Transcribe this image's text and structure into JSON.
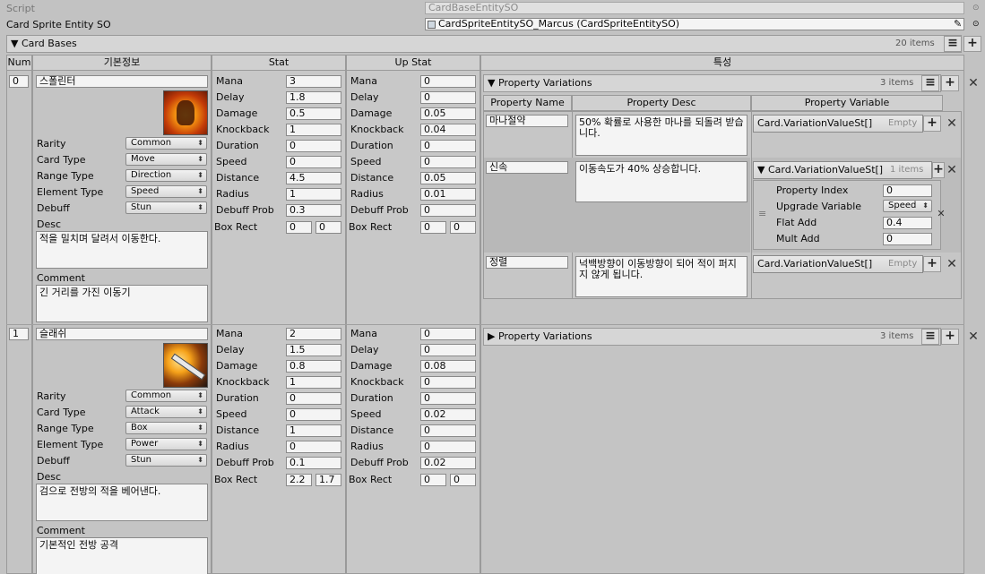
{
  "script_row": {
    "label": "Script",
    "value": "CardBaseEntitySO"
  },
  "sprite_row": {
    "label": "Card Sprite Entity SO",
    "value": "CardSpriteEntitySO_Marcus (CardSpriteEntitySO)"
  },
  "card_bases": {
    "label": "Card Bases",
    "count": "20 items"
  },
  "columns": {
    "num": "Num",
    "info": "기본정보",
    "stat": "Stat",
    "upstat": "Up Stat",
    "trait": "특성"
  },
  "field_labels": {
    "rarity": "Rarity",
    "card_type": "Card Type",
    "range_type": "Range Type",
    "element_type": "Element Type",
    "debuff": "Debuff",
    "desc": "Desc",
    "comment": "Comment"
  },
  "stat_labels": [
    "Mana",
    "Delay",
    "Damage",
    "Knockback",
    "Duration",
    "Speed",
    "Distance",
    "Radius",
    "Debuff Prob",
    "Box Rect"
  ],
  "pv_labels": {
    "title": "Property Variations",
    "name_col": "Property Name",
    "desc_col": "Property Desc",
    "var_col": "Property Variable",
    "empty": "Empty",
    "variation_type": "Card.VariationValueSt[]"
  },
  "sub_labels": {
    "property_index": "Property Index",
    "upgrade_variable": "Upgrade Variable",
    "flat_add": "Flat Add",
    "mult_add": "Mult Add"
  },
  "cards": [
    {
      "num": "0",
      "name": "스폴린터",
      "rarity": "Common",
      "card_type": "Move",
      "range_type": "Direction",
      "element_type": "Speed",
      "debuff": "Stun",
      "desc": "적을 밀치며 달려서 이동한다.",
      "comment": "긴 거리를 가진 이동기",
      "stat": [
        "3",
        "1.8",
        "0.5",
        "1",
        "0",
        "0",
        "4.5",
        "1",
        "0.3"
      ],
      "stat_box": [
        "0",
        "0"
      ],
      "upstat": [
        "0",
        "0",
        "0.05",
        "0.04",
        "0",
        "0",
        "0.05",
        "0.01",
        "0"
      ],
      "upstat_box": [
        "0",
        "0"
      ],
      "pv_count": "3 items",
      "properties": [
        {
          "name": "마나절약",
          "desc": "50% 확률로 사용한 마나를 되돌려 받습니다."
        },
        {
          "name": "신속",
          "desc": "이동속도가 40% 상승합니다.",
          "sub_count": "1 items",
          "sub": {
            "property_index": "0",
            "upgrade_variable": "Speed",
            "flat_add": "0.4",
            "mult_add": "0"
          }
        },
        {
          "name": "정렬",
          "desc": "넉백방향이 이동방향이 되어 적이 퍼지지 않게 됩니다."
        }
      ]
    },
    {
      "num": "1",
      "name": "슬래쉬",
      "rarity": "Common",
      "card_type": "Attack",
      "range_type": "Box",
      "element_type": "Power",
      "debuff": "Stun",
      "desc": "검으로 전방의 적을 베어낸다.",
      "comment": "기본적인 전방 공격",
      "stat": [
        "2",
        "1.5",
        "0.8",
        "1",
        "0",
        "0",
        "1",
        "0",
        "0.1"
      ],
      "stat_box": [
        "2.2",
        "1.7"
      ],
      "upstat": [
        "0",
        "0",
        "0.08",
        "0",
        "0",
        "0.02",
        "0",
        "0",
        "0.02"
      ],
      "upstat_box": [
        "0",
        "0"
      ],
      "pv_count": "3 items"
    }
  ]
}
